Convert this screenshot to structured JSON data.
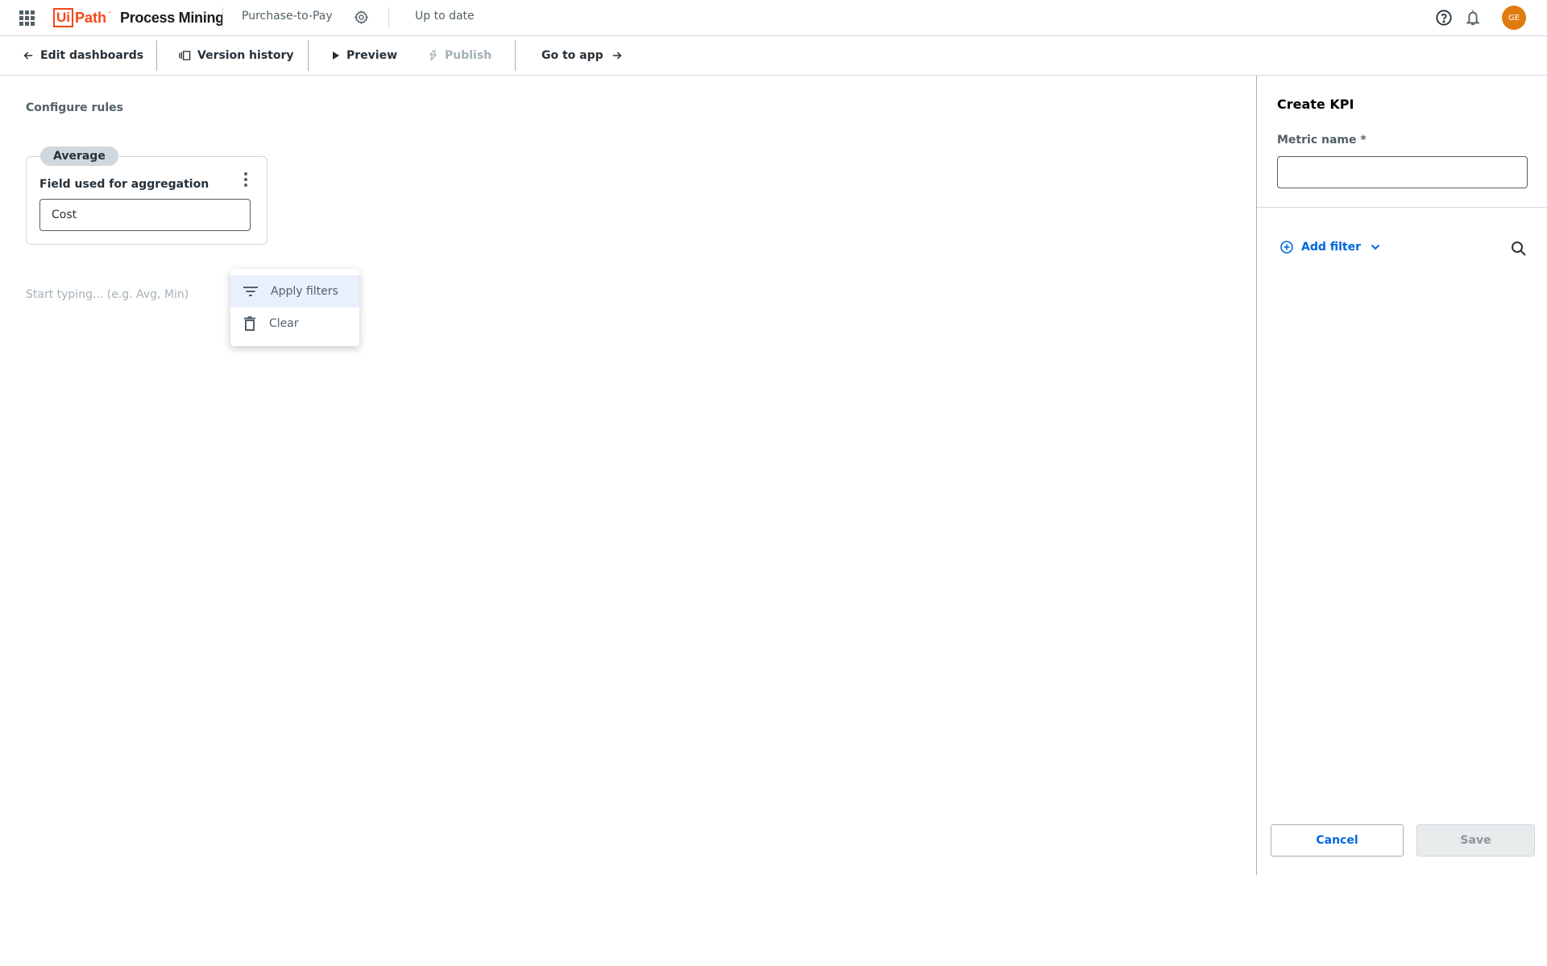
{
  "header": {
    "logo_ui": "Ui",
    "logo_path": "Path",
    "logo_tm": "™",
    "product": "Process Mining",
    "project_name": "Purchase-to-Pay",
    "status": "Up to date",
    "avatar_initials": "GE",
    "icons": [
      "apps-grid-icon",
      "gear-icon",
      "help-icon",
      "bell-icon"
    ]
  },
  "toolbar": {
    "edit_dashboards": "Edit dashboards",
    "version_history": "Version history",
    "preview": "Preview",
    "publish": "Publish",
    "go_to_app": "Go to app"
  },
  "main": {
    "section_title": "Configure rules",
    "rule": {
      "aggregation": "Average",
      "field_label": "Field used for aggregation",
      "field_value": "Cost"
    },
    "context_menu": {
      "items": [
        {
          "label": "Apply filters",
          "icon": "filter-icon",
          "highlighted": true
        },
        {
          "label": "Clear",
          "icon": "trash-icon",
          "highlighted": false
        }
      ]
    },
    "typing_hint": "Start typing... (e.g. Avg, Min)"
  },
  "panel": {
    "title": "Create KPI",
    "metric_label": "Metric name *",
    "metric_value": "",
    "add_filter": "Add filter",
    "cancel": "Cancel",
    "save": "Save"
  },
  "colors": {
    "brand": "#fa4616",
    "accent": "#0067df",
    "avatar": "#e07b0f",
    "menu_highlight": "#e9f0fb"
  }
}
